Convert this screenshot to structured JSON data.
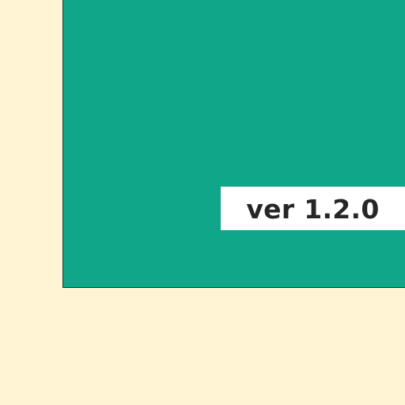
{
  "colors": {
    "background": "#FFF4D4",
    "panel": "#0FA68A",
    "panel_border": "#1C3B33",
    "badge_background": "#FFFFFF",
    "badge_text": "#262626"
  },
  "version_badge": {
    "label": "ver 1.2.0"
  }
}
